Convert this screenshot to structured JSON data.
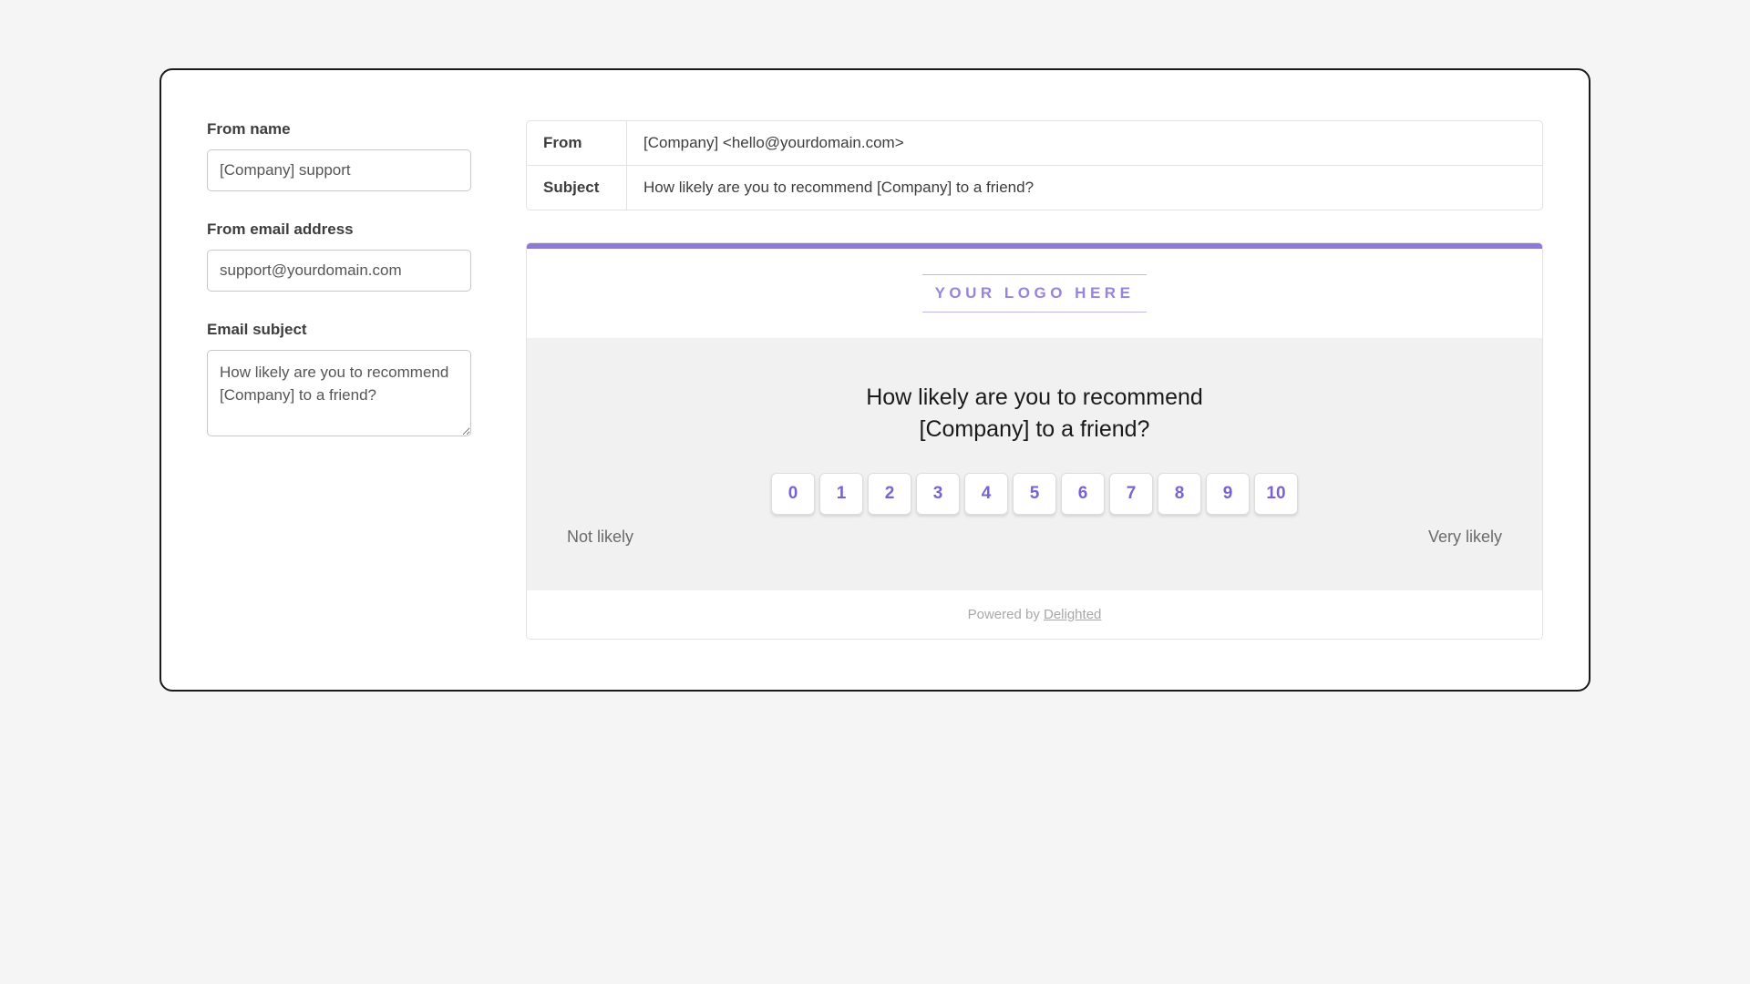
{
  "form": {
    "from_name_label": "From name",
    "from_name_value": "[Company] support",
    "from_email_label": "From email address",
    "from_email_value": "support@yourdomain.com",
    "subject_label": "Email subject",
    "subject_value": "How likely are you to recommend [Company] to a friend?"
  },
  "email_headers": {
    "from_key": "From",
    "from_value": "[Company] <hello@yourdomain.com>",
    "subject_key": "Subject",
    "subject_value": "How likely are you to recommend [Company] to a friend?"
  },
  "preview": {
    "logo_text": "YOUR LOGO HERE",
    "question": "How likely are you to recommend [Company] to a friend?",
    "scores": [
      "0",
      "1",
      "2",
      "3",
      "4",
      "5",
      "6",
      "7",
      "8",
      "9",
      "10"
    ],
    "low_label": "Not likely",
    "high_label": "Very likely",
    "footer_prefix": "Powered by ",
    "footer_link": "Delighted"
  },
  "colors": {
    "accent": "#8d79d6"
  }
}
